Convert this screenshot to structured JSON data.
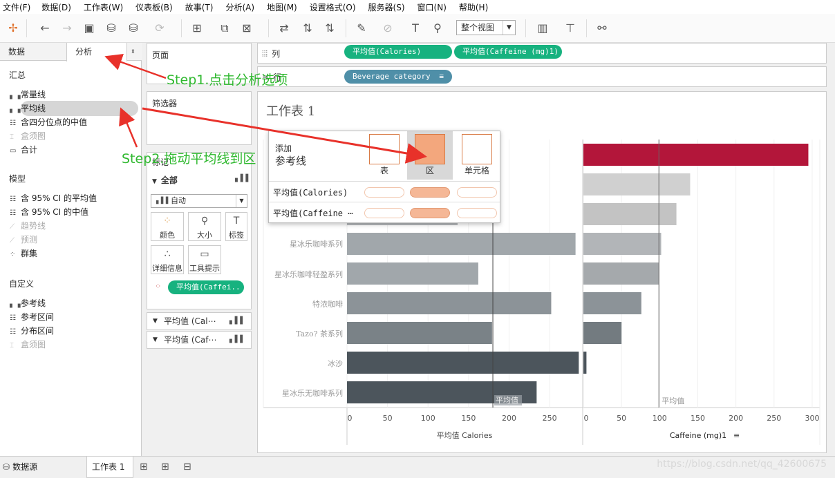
{
  "menu": [
    "文件(F)",
    "数据(D)",
    "工作表(W)",
    "仪表板(B)",
    "故事(T)",
    "分析(A)",
    "地图(M)",
    "设置格式(O)",
    "服务器(S)",
    "窗口(N)",
    "帮助(H)"
  ],
  "toolbar": {
    "view_select": "整个视图"
  },
  "left_panel": {
    "tabs": [
      "数据",
      "分析"
    ],
    "summary_header": "汇总",
    "summary_items": [
      "常量线",
      "平均线",
      "含四分位点的中值",
      "盒须图",
      "合计"
    ],
    "model_header": "模型",
    "model_items": [
      "含 95% CI 的平均值",
      "含 95% CI 的中值",
      "趋势线",
      "预测",
      "群集"
    ],
    "custom_header": "自定义",
    "custom_items": [
      "参考线",
      "参考区间",
      "分布区间",
      "盒须图"
    ]
  },
  "shelves": {
    "pages": "页面",
    "filters": "筛选器",
    "marks": "标记",
    "marks_all": "全部",
    "marks_type": "自动",
    "mark_buttons": [
      "颜色",
      "大小",
      "标签",
      "详细信息",
      "工具提示"
    ],
    "marks_pill": "平均值(Caffei..",
    "marks_rows": [
      "平均值 (Cal⋯",
      "平均值 (Caf⋯"
    ],
    "columns_label": "列",
    "columns_pills": [
      "平均值(Calories)",
      "平均值(Caffeine (mg)1)"
    ],
    "rows_label": "行",
    "rows_pill": "Beverage category"
  },
  "sheet_title": "工作表 1",
  "popup": {
    "title_line1": "添加",
    "title_line2": "参考线",
    "options": [
      "表",
      "区",
      "单元格"
    ],
    "rows": [
      "平均值(Calories)",
      "平均值(Caffeine ⋯"
    ]
  },
  "chart_data": [
    {
      "type": "bar",
      "categories": [
        "星冰乐咖啡系列",
        "星冰乐咖啡轻盈系列",
        "特浓咖啡",
        "Tazo? 茶系列",
        "冰沙",
        "星冰乐无咖啡系列"
      ],
      "values": [
        282,
        162,
        252,
        179,
        286,
        234
      ],
      "xlabel": "平均值 Calories",
      "xlim": [
        0,
        290
      ],
      "ticks": [
        0,
        50,
        100,
        150,
        200,
        250
      ],
      "reference_line": 180,
      "reference_label": "平均值",
      "colors": [
        "#a1a7ab",
        "#a1a7ab",
        "#8c9398",
        "#7a8287",
        "#4c555c",
        "#4c555c"
      ]
    },
    {
      "type": "bar",
      "values": [
        295,
        140,
        122,
        102,
        99,
        76,
        50,
        4
      ],
      "xlabel": "Caffeine (mg)1",
      "xlim": [
        0,
        310
      ],
      "ticks": [
        0,
        50,
        100,
        150,
        200,
        250,
        300
      ],
      "reference_line": 99,
      "reference_label": "平均值",
      "colors": [
        "#b3163a",
        "#d0d0d0",
        "#c3c3c3",
        "#b2b5b8",
        "#a5a9ac",
        "#8c9398",
        "#737b80",
        "#4c555c"
      ]
    }
  ],
  "annotations": {
    "step1": "Step1.点击分析选项",
    "step2": "Step2.拖动平均线到区"
  },
  "bottom": {
    "datasource": "数据源",
    "sheet_tab": "工作表 1"
  },
  "watermark": "https://blog.csdn.net/qq_42600675"
}
